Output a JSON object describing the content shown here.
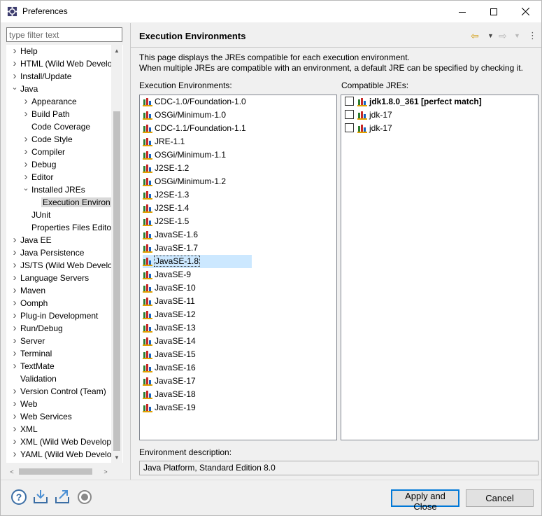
{
  "window": {
    "title": "Preferences"
  },
  "filter": {
    "placeholder": "type filter text"
  },
  "tree": [
    {
      "label": "Help",
      "indent": 0,
      "chev": ">"
    },
    {
      "label": "HTML (Wild Web Develo",
      "indent": 0,
      "chev": ">"
    },
    {
      "label": "Install/Update",
      "indent": 0,
      "chev": ">"
    },
    {
      "label": "Java",
      "indent": 0,
      "chev": "v"
    },
    {
      "label": "Appearance",
      "indent": 1,
      "chev": ">"
    },
    {
      "label": "Build Path",
      "indent": 1,
      "chev": ">"
    },
    {
      "label": "Code Coverage",
      "indent": 1,
      "chev": ""
    },
    {
      "label": "Code Style",
      "indent": 1,
      "chev": ">"
    },
    {
      "label": "Compiler",
      "indent": 1,
      "chev": ">"
    },
    {
      "label": "Debug",
      "indent": 1,
      "chev": ">"
    },
    {
      "label": "Editor",
      "indent": 1,
      "chev": ">"
    },
    {
      "label": "Installed JREs",
      "indent": 1,
      "chev": "v"
    },
    {
      "label": "Execution Environ",
      "indent": 2,
      "chev": "",
      "selected": true
    },
    {
      "label": "JUnit",
      "indent": 1,
      "chev": ""
    },
    {
      "label": "Properties Files Edito",
      "indent": 1,
      "chev": ""
    },
    {
      "label": "Java EE",
      "indent": 0,
      "chev": ">"
    },
    {
      "label": "Java Persistence",
      "indent": 0,
      "chev": ">"
    },
    {
      "label": "JS/TS (Wild Web Develo",
      "indent": 0,
      "chev": ">"
    },
    {
      "label": "Language Servers",
      "indent": 0,
      "chev": ">"
    },
    {
      "label": "Maven",
      "indent": 0,
      "chev": ">"
    },
    {
      "label": "Oomph",
      "indent": 0,
      "chev": ">"
    },
    {
      "label": "Plug-in Development",
      "indent": 0,
      "chev": ">"
    },
    {
      "label": "Run/Debug",
      "indent": 0,
      "chev": ">"
    },
    {
      "label": "Server",
      "indent": 0,
      "chev": ">"
    },
    {
      "label": "Terminal",
      "indent": 0,
      "chev": ">"
    },
    {
      "label": "TextMate",
      "indent": 0,
      "chev": ">"
    },
    {
      "label": "Validation",
      "indent": 0,
      "chev": ""
    },
    {
      "label": "Version Control (Team)",
      "indent": 0,
      "chev": ">"
    },
    {
      "label": "Web",
      "indent": 0,
      "chev": ">"
    },
    {
      "label": "Web Services",
      "indent": 0,
      "chev": ">"
    },
    {
      "label": "XML",
      "indent": 0,
      "chev": ">"
    },
    {
      "label": "XML (Wild Web Develop",
      "indent": 0,
      "chev": ">"
    },
    {
      "label": "YAML (Wild Web Develo",
      "indent": 0,
      "chev": ">"
    }
  ],
  "page": {
    "title": "Execution Environments",
    "description_line1": "This page displays the JREs compatible for each execution environment.",
    "description_line2": "When multiple JREs are compatible with an environment, a default JRE can be specified by checking it.",
    "envs_label": "Execution Environments:",
    "jres_label": "Compatible JREs:",
    "environments": [
      "CDC-1.0/Foundation-1.0",
      "OSGi/Minimum-1.0",
      "CDC-1.1/Foundation-1.1",
      "JRE-1.1",
      "OSGi/Minimum-1.1",
      "J2SE-1.2",
      "OSGi/Minimum-1.2",
      "J2SE-1.3",
      "J2SE-1.4",
      "J2SE-1.5",
      "JavaSE-1.6",
      "JavaSE-1.7",
      "JavaSE-1.8",
      "JavaSE-9",
      "JavaSE-10",
      "JavaSE-11",
      "JavaSE-12",
      "JavaSE-13",
      "JavaSE-14",
      "JavaSE-15",
      "JavaSE-16",
      "JavaSE-17",
      "JavaSE-18",
      "JavaSE-19"
    ],
    "selected_environment": "JavaSE-1.8",
    "jres": [
      {
        "name": "jdk1.8.0_361 [perfect match]",
        "checked": false,
        "bold": true
      },
      {
        "name": "jdk-17",
        "checked": false,
        "bold": false
      },
      {
        "name": "jdk-17",
        "checked": false,
        "bold": false
      }
    ],
    "env_desc_label": "Environment description:",
    "env_desc_value": "Java Platform, Standard Edition 8.0"
  },
  "buttons": {
    "apply_close": "Apply and Close",
    "cancel": "Cancel"
  },
  "colors": {
    "selection": "#cce8ff",
    "default_button_border": "#0078d7"
  }
}
